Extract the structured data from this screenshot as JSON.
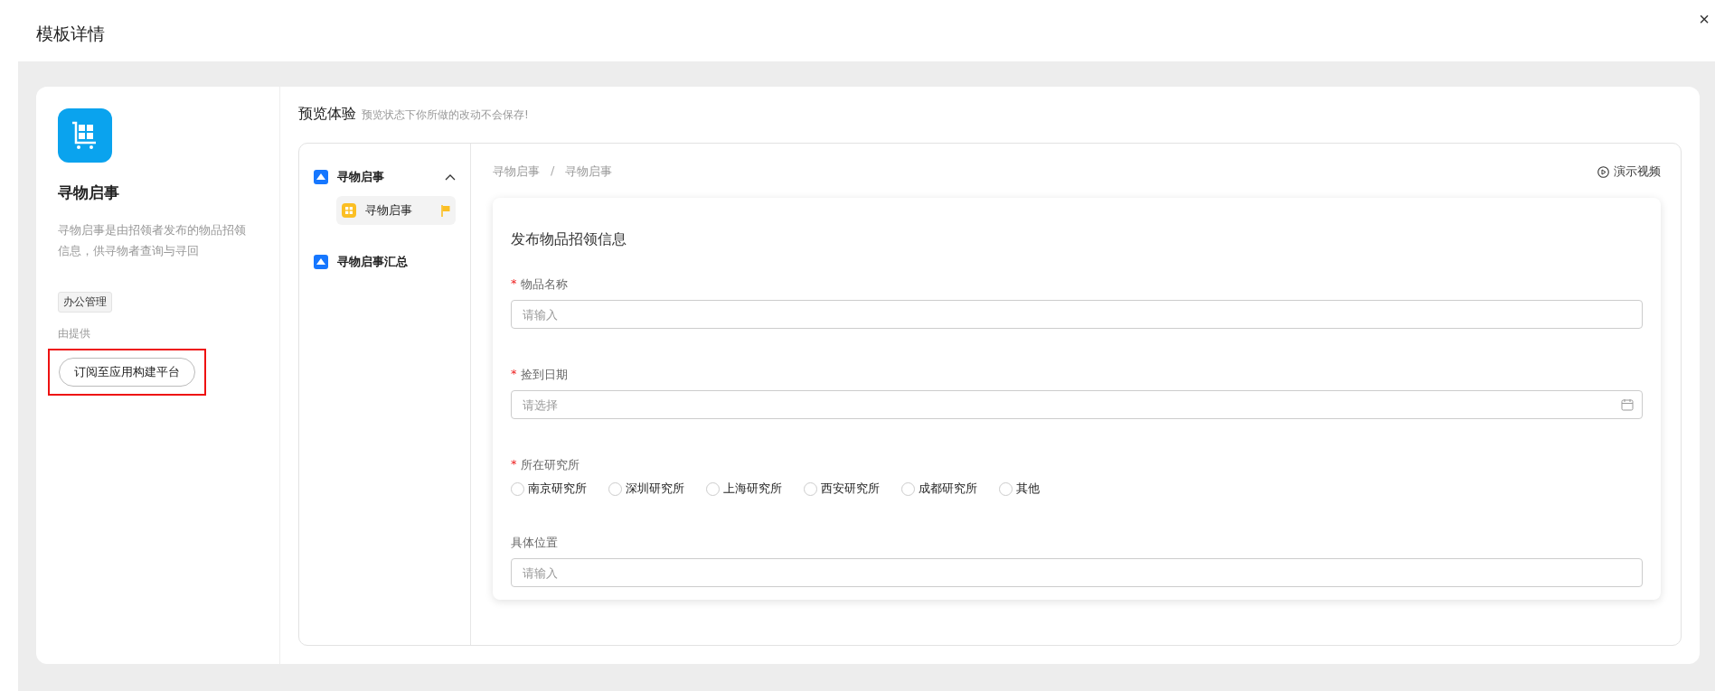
{
  "dialog": {
    "title": "模板详情",
    "close_label": "×"
  },
  "template": {
    "name": "寻物启事",
    "description": "寻物启事是由招领者发布的物品招领信息，供寻物者查询与寻回",
    "tag": "办公管理",
    "provider": "由提供",
    "subscribe_button": "订阅至应用构建平台",
    "highlighted": true
  },
  "preview": {
    "title": "预览体验",
    "note": "预览状态下你所做的改动不会保存!"
  },
  "nav": [
    {
      "label": "寻物启事",
      "expanded": true,
      "children": [
        {
          "label": "寻物启事",
          "selected": true,
          "flagged": true
        }
      ]
    },
    {
      "label": "寻物启事汇总"
    }
  ],
  "breadcrumb": [
    "寻物启事",
    "寻物启事"
  ],
  "breadcrumb_separator": "/",
  "demo_video": "演示视频",
  "form": {
    "title": "发布物品招领信息",
    "required_mark": "*",
    "fields": [
      {
        "kind": "text",
        "label": "物品名称",
        "required": true,
        "placeholder": "请输入"
      },
      {
        "kind": "date",
        "label": "捡到日期",
        "required": true,
        "placeholder": "请选择"
      },
      {
        "kind": "radio",
        "label": "所在研究所",
        "required": true,
        "options": [
          {
            "label": "南京研究所",
            "selected": false
          },
          {
            "label": "深圳研究所",
            "selected": false
          },
          {
            "label": "上海研究所",
            "selected": false
          },
          {
            "label": "西安研究所",
            "selected": false
          },
          {
            "label": "成都研究所",
            "selected": false
          },
          {
            "label": "其他",
            "selected": false
          }
        ]
      },
      {
        "kind": "text",
        "label": "具体位置",
        "required": false,
        "placeholder": "请输入"
      }
    ]
  }
}
